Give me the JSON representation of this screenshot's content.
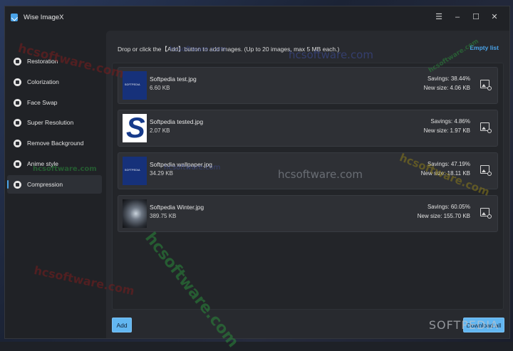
{
  "app": {
    "title": "Wise ImageX"
  },
  "window_controls": [
    "☰",
    "–",
    "☐",
    "✕"
  ],
  "sidebar": {
    "items": [
      {
        "label": "Restoration",
        "icon": "restoration-icon",
        "active": false
      },
      {
        "label": "Colorization",
        "icon": "colorization-icon",
        "active": false
      },
      {
        "label": "Face Swap",
        "icon": "face-swap-icon",
        "active": false
      },
      {
        "label": "Super Resolution",
        "icon": "super-resolution-icon",
        "active": false
      },
      {
        "label": "Remove Background",
        "icon": "remove-background-icon",
        "active": false
      },
      {
        "label": "Anime style",
        "icon": "anime-style-icon",
        "active": false
      },
      {
        "label": "Compression",
        "icon": "compression-icon",
        "active": true
      }
    ]
  },
  "main": {
    "hint": "Drop or click the【Add】button to add images. (Up to 20 images, max 5 MB each.)",
    "empty_list_label": "Empty list",
    "files": [
      {
        "name": "Softpedia test.jpg",
        "size": "6.60 KB",
        "savings": "Savings: 38.44%",
        "new_size": "New size: 4.06 KB"
      },
      {
        "name": "Softpedia tested.jpg",
        "size": "2.07 KB",
        "savings": "Savings: 4.86%",
        "new_size": "New size: 1.97 KB"
      },
      {
        "name": "Softpedia wallpaper.jpg",
        "size": "34.29 KB",
        "savings": "Savings: 47.19%",
        "new_size": "New size: 18.11 KB"
      },
      {
        "name": "Softpedia Winter.jpg",
        "size": "389.75 KB",
        "savings": "Savings: 60.05%",
        "new_size": "New size: 155.70 KB"
      }
    ],
    "add_label": "Add",
    "download_all_label": "Download all"
  },
  "watermarks": {
    "hcsoftware": "hcsoftware.com",
    "softpedia": "SOFTPEDIA"
  },
  "colors": {
    "accent": "#4aa3e8",
    "button": "#62b6f1",
    "window_bg": "#202226"
  }
}
